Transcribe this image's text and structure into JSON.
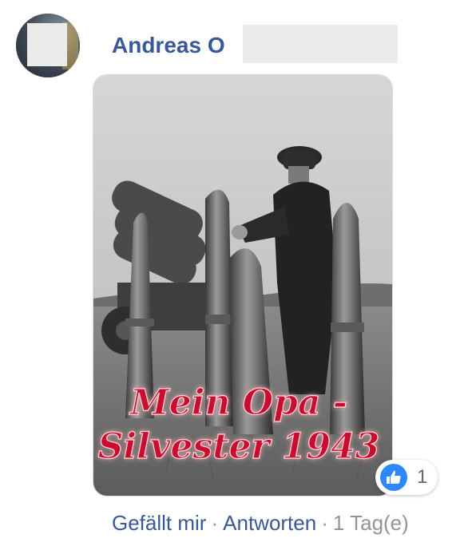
{
  "comment": {
    "author_name": "Andreas O",
    "image": {
      "caption_line1": "Mein Opa -",
      "caption_line2": "Silvester 1943"
    },
    "reaction_count": "1",
    "actions": {
      "like_label": "Gefällt mir",
      "reply_label": "Antworten",
      "separator": "·",
      "timestamp": "1 Tag(e)"
    }
  },
  "colors": {
    "link": "#385898",
    "muted": "#90949c",
    "like_blue": "#2d88ff",
    "caption_red": "#c8102e"
  },
  "icons": [
    "avatar-photo",
    "thumbs-up-icon"
  ]
}
